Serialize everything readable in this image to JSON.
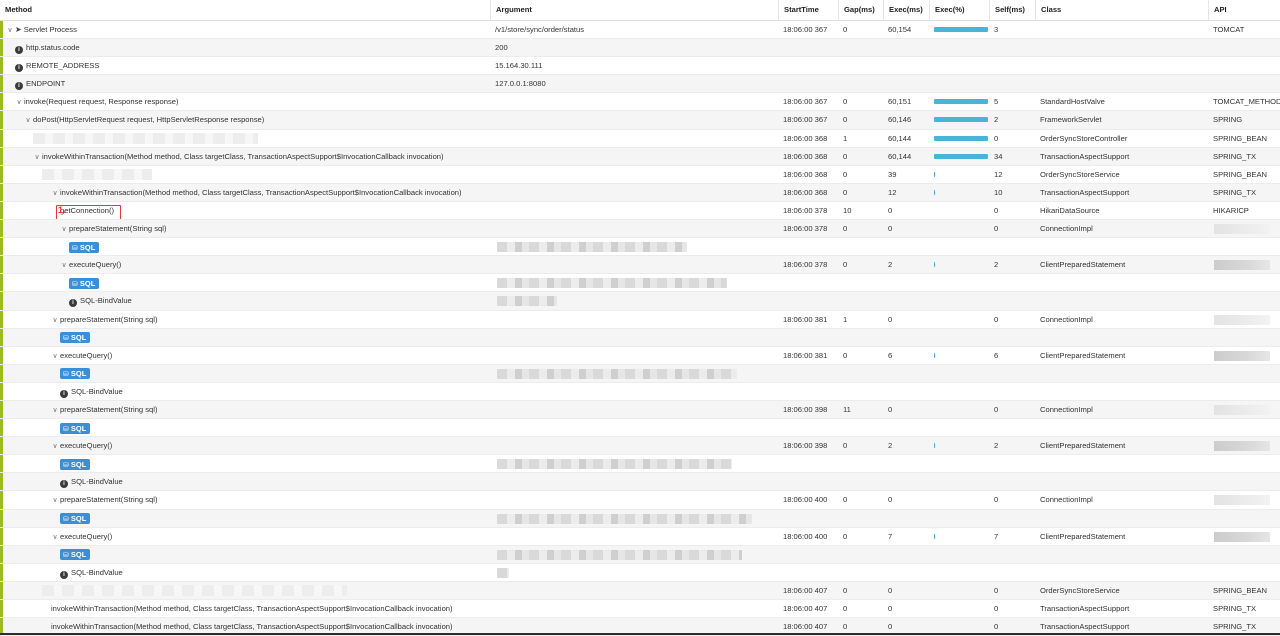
{
  "columns": {
    "method": "Method",
    "argument": "Argument",
    "start_time": "StartTime",
    "gap": "Gap(ms)",
    "exec": "Exec(ms)",
    "exec_pct": "Exec(%)",
    "self": "Self(ms)",
    "class": "Class",
    "api": "API"
  },
  "annotation": {
    "label": "1."
  },
  "colors": {
    "accent_bar": "#9bbb1f",
    "progress": "#4ab3d8",
    "sql_badge": "#3a8fd8",
    "highlight": "#e53935"
  },
  "rows": [
    {
      "type": "method",
      "indent": 0,
      "chev": "v",
      "icon": "send-icon",
      "method": "Servlet Process",
      "argument": "/v1/store/sync/order/status",
      "start": "18:06:00 367",
      "gap": "0",
      "exec": "60,154",
      "pct": 0.98,
      "self": "3",
      "class": "",
      "api": "TOMCAT"
    },
    {
      "type": "info",
      "indent": 1,
      "method": "http.status.code",
      "argument": "200"
    },
    {
      "type": "info",
      "indent": 1,
      "method": "REMOTE_ADDRESS",
      "argument": "15.164.30.111"
    },
    {
      "type": "info",
      "indent": 1,
      "method": "ENDPOINT",
      "argument": "127.0.0.1:8080"
    },
    {
      "type": "method",
      "indent": 1,
      "chev": "v",
      "method": "invoke(Request request, Response response)",
      "start": "18:06:00 367",
      "gap": "0",
      "exec": "60,151",
      "pct": 0.98,
      "self": "5",
      "class": "StandardHostValve",
      "api": "TOMCAT_METHOD"
    },
    {
      "type": "method",
      "indent": 2,
      "chev": "v",
      "method": "doPost(HttpServletRequest request, HttpServletResponse response)",
      "start": "18:06:00 367",
      "gap": "0",
      "exec": "60,146",
      "pct": 0.98,
      "self": "2",
      "class": "FrameworkServlet",
      "api": "SPRING"
    },
    {
      "type": "method",
      "indent": 3,
      "blurMethod": true,
      "blurW": 225,
      "method": "",
      "start": "18:06:00 368",
      "gap": "1",
      "exec": "60,144",
      "pct": 0.98,
      "self": "0",
      "class": "OrderSyncStoreController",
      "api": "SPRING_BEAN"
    },
    {
      "type": "method",
      "indent": 3,
      "chev": "v",
      "method": "invokeWithinTransaction(Method method, Class targetClass, TransactionAspectSupport$InvocationCallback invocation)",
      "start": "18:06:00 368",
      "gap": "0",
      "exec": "60,144",
      "pct": 0.98,
      "self": "34",
      "class": "TransactionAspectSupport",
      "api": "SPRING_TX"
    },
    {
      "type": "method",
      "indent": 4,
      "blurMethod": true,
      "blurW": 110,
      "method": "",
      "start": "18:06:00 368",
      "gap": "0",
      "exec": "39",
      "pct": 0.004,
      "self": "12",
      "class": "OrderSyncStoreService",
      "api": "SPRING_BEAN"
    },
    {
      "type": "method",
      "indent": 5,
      "chev": "v",
      "method": "invokeWithinTransaction(Method method, Class targetClass, TransactionAspectSupport$InvocationCallback invocation)",
      "start": "18:06:00 368",
      "gap": "0",
      "exec": "12",
      "pct": 0.002,
      "self": "10",
      "class": "TransactionAspectSupport",
      "api": "SPRING_TX"
    },
    {
      "type": "method",
      "indent": 6,
      "highlight": true,
      "method": "getConnection()",
      "start": "18:06:00 378",
      "gap": "10",
      "exec": "0",
      "pct": 0,
      "self": "0",
      "class": "HikariDataSource",
      "api": "HIKARICP"
    },
    {
      "type": "method",
      "indent": 6,
      "chev": "v",
      "method": "prepareStatement(String sql)",
      "start": "18:06:00 378",
      "gap": "0",
      "exec": "0",
      "pct": 0,
      "self": "0",
      "class": "ConnectionImpl",
      "blurApi": "light"
    },
    {
      "type": "sql",
      "indent": 7,
      "blurArg": 190
    },
    {
      "type": "method",
      "indent": 6,
      "chev": "v",
      "method": "executeQuery()",
      "start": "18:06:00 378",
      "gap": "0",
      "exec": "2",
      "pct": 0.002,
      "self": "2",
      "class": "ClientPreparedStatement",
      "blurApi": "dark"
    },
    {
      "type": "sql",
      "indent": 7,
      "blurArg": 230
    },
    {
      "type": "info",
      "indent": 7,
      "method": "SQL-BindValue",
      "blurArg": 60
    },
    {
      "type": "method",
      "indent": 5,
      "chev": "v",
      "method": "prepareStatement(String sql)",
      "start": "18:06:00 381",
      "gap": "1",
      "exec": "0",
      "pct": 0,
      "self": "0",
      "class": "ConnectionImpl",
      "blurApi": "light"
    },
    {
      "type": "sql",
      "indent": 6,
      "blurArg": 0
    },
    {
      "type": "method",
      "indent": 5,
      "chev": "v",
      "method": "executeQuery()",
      "start": "18:06:00 381",
      "gap": "0",
      "exec": "6",
      "pct": 0.003,
      "self": "6",
      "class": "ClientPreparedStatement",
      "blurApi": "dark"
    },
    {
      "type": "sql",
      "indent": 6,
      "blurArg": 240
    },
    {
      "type": "info",
      "indent": 6,
      "method": "SQL-BindValue",
      "blurArg": 0
    },
    {
      "type": "method",
      "indent": 5,
      "chev": "v",
      "method": "prepareStatement(String sql)",
      "start": "18:06:00 398",
      "gap": "11",
      "exec": "0",
      "pct": 0,
      "self": "0",
      "class": "ConnectionImpl",
      "blurApi": "light"
    },
    {
      "type": "sql",
      "indent": 6,
      "blurArg": 0
    },
    {
      "type": "method",
      "indent": 5,
      "chev": "v",
      "method": "executeQuery()",
      "start": "18:06:00 398",
      "gap": "0",
      "exec": "2",
      "pct": 0.002,
      "self": "2",
      "class": "ClientPreparedStatement",
      "blurApi": "dark"
    },
    {
      "type": "sql",
      "indent": 6,
      "blurArg": 235
    },
    {
      "type": "info",
      "indent": 6,
      "method": "SQL-BindValue",
      "blurArg": 0
    },
    {
      "type": "method",
      "indent": 5,
      "chev": "v",
      "method": "prepareStatement(String sql)",
      "start": "18:06:00 400",
      "gap": "0",
      "exec": "0",
      "pct": 0,
      "self": "0",
      "class": "ConnectionImpl",
      "blurApi": "light"
    },
    {
      "type": "sql",
      "indent": 6,
      "blurArg": 255
    },
    {
      "type": "method",
      "indent": 5,
      "chev": "v",
      "method": "executeQuery()",
      "start": "18:06:00 400",
      "gap": "0",
      "exec": "7",
      "pct": 0.003,
      "self": "7",
      "class": "ClientPreparedStatement",
      "blurApi": "dark"
    },
    {
      "type": "sql",
      "indent": 6,
      "blurArg": 245
    },
    {
      "type": "info",
      "indent": 6,
      "method": "SQL-BindValue",
      "blurArg": 12
    },
    {
      "type": "method",
      "indent": 4,
      "blurMethod": true,
      "blurW": 305,
      "method": "",
      "start": "18:06:00 407",
      "gap": "0",
      "exec": "0",
      "pct": 0,
      "self": "0",
      "class": "OrderSyncStoreService",
      "api": "SPRING_BEAN"
    },
    {
      "type": "method",
      "indent": 5,
      "method": "invokeWithinTransaction(Method method, Class targetClass, TransactionAspectSupport$InvocationCallback invocation)",
      "start": "18:06:00 407",
      "gap": "0",
      "exec": "0",
      "pct": 0,
      "self": "0",
      "class": "TransactionAspectSupport",
      "api": "SPRING_TX"
    },
    {
      "type": "method",
      "indent": 5,
      "method": "invokeWithinTransaction(Method method, Class targetClass, TransactionAspectSupport$InvocationCallback invocation)",
      "start": "18:06:00 407",
      "gap": "0",
      "exec": "0",
      "pct": 0,
      "self": "0",
      "class": "TransactionAspectSupport",
      "api": "SPRING_TX"
    }
  ]
}
